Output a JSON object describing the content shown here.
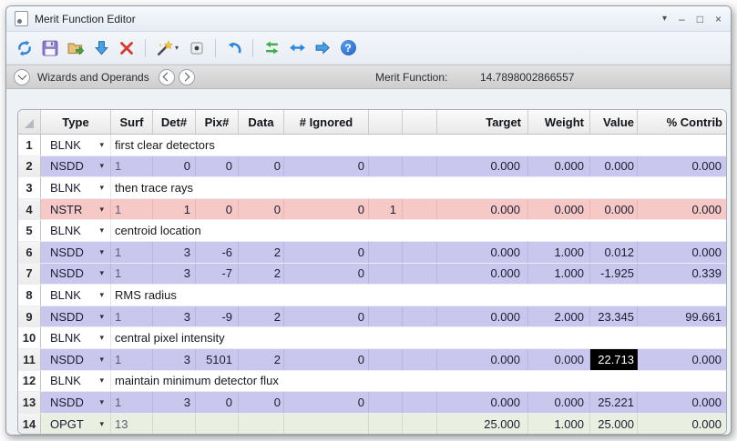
{
  "window": {
    "title": "Merit Function Editor",
    "controls": {
      "menu": "▾",
      "minimize": "–",
      "maximize": "□",
      "close": "×"
    }
  },
  "toolbar": {
    "buttons": [
      "update",
      "save",
      "load",
      "insert-operand",
      "delete-operand",
      "optimization-wizard",
      "detector-viewer",
      "undo",
      "swap-rows",
      "fit-columns",
      "go-forward",
      "help"
    ]
  },
  "wizards_bar": {
    "label": "Wizards and Operands",
    "merit_label": "Merit Function:",
    "merit_value": "14.7898002866557"
  },
  "table": {
    "columns": [
      "",
      "Type",
      "Surf",
      "Det#",
      "Pix#",
      "Data",
      "# Ignored",
      "",
      "",
      "Target",
      "Weight",
      "Value",
      "% Contrib"
    ],
    "type_caret": "▾",
    "rows": [
      {
        "num": "1",
        "type": "BLNK",
        "style": "blank",
        "comment": "first clear detectors"
      },
      {
        "num": "2",
        "type": "NSDD",
        "style": "lavender",
        "surf": "1",
        "det": "0",
        "pix": "0",
        "data": "0",
        "ignored": "0",
        "x1": "",
        "x2": "",
        "target": "0.000",
        "weight": "0.000",
        "value": "0.000",
        "contrib": "0.000"
      },
      {
        "num": "3",
        "type": "BLNK",
        "style": "blank",
        "comment": "then trace rays"
      },
      {
        "num": "4",
        "type": "NSTR",
        "style": "pink",
        "surf": "1",
        "det": "1",
        "pix": "0",
        "data": "0",
        "ignored": "0",
        "x1": "1",
        "x2": "",
        "target": "0.000",
        "weight": "0.000",
        "value": "0.000",
        "contrib": "0.000"
      },
      {
        "num": "5",
        "type": "BLNK",
        "style": "blank",
        "comment": "centroid location"
      },
      {
        "num": "6",
        "type": "NSDD",
        "style": "lavender",
        "surf": "1",
        "det": "3",
        "pix": "-6",
        "data": "2",
        "ignored": "0",
        "x1": "",
        "x2": "",
        "target": "0.000",
        "weight": "1.000",
        "value": "0.012",
        "contrib": "0.000"
      },
      {
        "num": "7",
        "type": "NSDD",
        "style": "lavender",
        "surf": "1",
        "det": "3",
        "pix": "-7",
        "data": "2",
        "ignored": "0",
        "x1": "",
        "x2": "",
        "target": "0.000",
        "weight": "1.000",
        "value": "-1.925",
        "contrib": "0.339"
      },
      {
        "num": "8",
        "type": "BLNK",
        "style": "blank",
        "comment": "RMS radius"
      },
      {
        "num": "9",
        "type": "NSDD",
        "style": "lavender",
        "surf": "1",
        "det": "3",
        "pix": "-9",
        "data": "2",
        "ignored": "0",
        "x1": "",
        "x2": "",
        "target": "0.000",
        "weight": "2.000",
        "value": "23.345",
        "contrib": "99.661"
      },
      {
        "num": "10",
        "type": "BLNK",
        "style": "blank",
        "comment": "central pixel intensity"
      },
      {
        "num": "11",
        "type": "NSDD",
        "style": "lavender",
        "surf": "1",
        "det": "3",
        "pix": "5101",
        "data": "2",
        "ignored": "0",
        "x1": "",
        "x2": "",
        "target": "0.000",
        "weight": "0.000",
        "value": "22.713",
        "value_selected": true,
        "contrib": "0.000"
      },
      {
        "num": "12",
        "type": "BLNK",
        "style": "blank",
        "comment": "maintain minimum detector flux"
      },
      {
        "num": "13",
        "type": "NSDD",
        "style": "lavender",
        "surf": "1",
        "det": "3",
        "pix": "0",
        "data": "0",
        "ignored": "0",
        "x1": "",
        "x2": "",
        "target": "0.000",
        "weight": "0.000",
        "value": "25.221",
        "contrib": "0.000"
      },
      {
        "num": "14",
        "type": "OPGT",
        "style": "green",
        "surf": "13",
        "det": "",
        "pix": "",
        "data": "",
        "ignored": "",
        "x1": "",
        "x2": "",
        "target": "25.000",
        "weight": "1.000",
        "value": "25.000",
        "contrib": "0.000"
      }
    ]
  }
}
